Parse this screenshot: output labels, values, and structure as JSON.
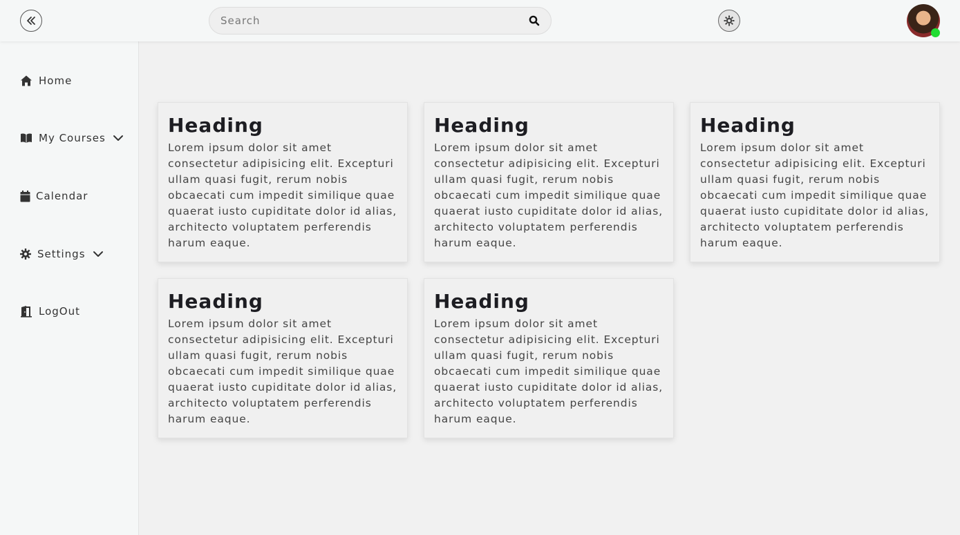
{
  "header": {
    "search_placeholder": "Search",
    "icons": {
      "collapse": "double-chevron-left-icon",
      "search": "search-icon",
      "theme": "gear-theme-icon"
    },
    "online_status_color": "#22dd33"
  },
  "sidebar": {
    "items": [
      {
        "label": "Home",
        "icon": "home-icon",
        "has_dropdown": false
      },
      {
        "label": "My Courses",
        "icon": "book-icon",
        "has_dropdown": true
      },
      {
        "label": "Calendar",
        "icon": "calendar-icon",
        "has_dropdown": false
      },
      {
        "label": "Settings",
        "icon": "gear-icon",
        "has_dropdown": true
      },
      {
        "label": "LogOut",
        "icon": "logout-icon",
        "has_dropdown": false
      }
    ]
  },
  "cards": [
    {
      "heading": "Heading",
      "body": "Lorem ipsum dolor sit amet consectetur adipisicing elit. Excepturi ullam quasi fugit, rerum nobis obcaecati cum impedit similique quae quaerat iusto cupiditate dolor id alias, architecto voluptatem perferendis harum eaque."
    },
    {
      "heading": "Heading",
      "body": "Lorem ipsum dolor sit amet consectetur adipisicing elit. Excepturi ullam quasi fugit, rerum nobis obcaecati cum impedit similique quae quaerat iusto cupiditate dolor id alias, architecto voluptatem perferendis harum eaque."
    },
    {
      "heading": "Heading",
      "body": "Lorem ipsum dolor sit amet consectetur adipisicing elit. Excepturi ullam quasi fugit, rerum nobis obcaecati cum impedit similique quae quaerat iusto cupiditate dolor id alias, architecto voluptatem perferendis harum eaque."
    },
    {
      "heading": "Heading",
      "body": "Lorem ipsum dolor sit amet consectetur adipisicing elit. Excepturi ullam quasi fugit, rerum nobis obcaecati cum impedit similique quae quaerat iusto cupiditate dolor id alias, architecto voluptatem perferendis harum eaque."
    },
    {
      "heading": "Heading",
      "body": "Lorem ipsum dolor sit amet consectetur adipisicing elit. Excepturi ullam quasi fugit, rerum nobis obcaecati cum impedit similique quae quaerat iusto cupiditate dolor id alias, architecto voluptatem perferendis harum eaque."
    }
  ]
}
